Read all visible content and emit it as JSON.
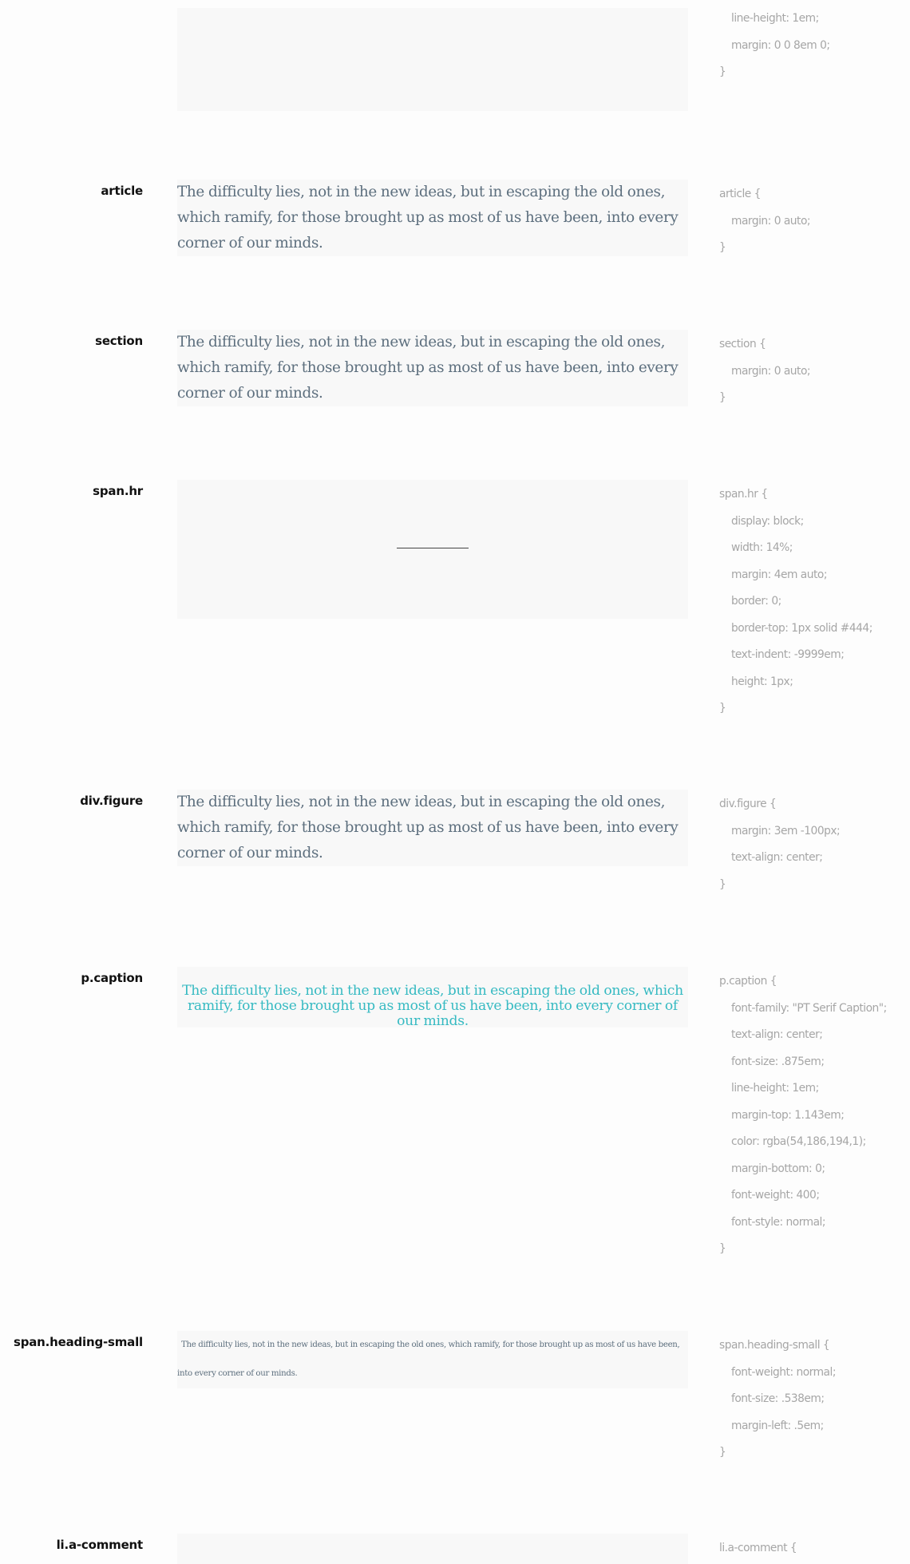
{
  "sample_text": "The difficulty lies, not in the new ideas, but in escaping the old ones, which ramify, for those brought up as most of us have been, into every corner of our minds.",
  "blocks": [
    {
      "selector": "",
      "rules": [
        "line-height: 1em;",
        "margin: 0 0 8em 0;"
      ],
      "close": "}"
    },
    {
      "selector": "article",
      "open": "article {",
      "rules": [
        "margin: 0 auto;"
      ],
      "close": "}"
    },
    {
      "selector": "section",
      "open": "section {",
      "rules": [
        "margin: 0 auto;"
      ],
      "close": "}"
    },
    {
      "selector": "span.hr",
      "open": "span.hr {",
      "rules": [
        "display: block;",
        "width: 14%;",
        "margin: 4em auto;",
        "border: 0;",
        "border-top: 1px solid #444;",
        "text-indent: -9999em;",
        "height: 1px;"
      ],
      "close": "}"
    },
    {
      "selector": "div.figure",
      "open": "div.figure {",
      "rules": [
        "margin: 3em -100px;",
        "text-align: center;"
      ],
      "close": "}"
    },
    {
      "selector": "p.caption",
      "open": "p.caption {",
      "rules": [
        "font-family: \"PT Serif Caption\";",
        "text-align: center;",
        "font-size: .875em;",
        "line-height: 1em;",
        "margin-top: 1.143em;",
        "color: rgba(54,186,194,1);",
        "margin-bottom: 0;",
        "font-weight: 400;",
        "font-style: normal;"
      ],
      "close": "}"
    },
    {
      "selector": "span.heading-small",
      "open": "span.heading-small {",
      "rules": [
        "font-weight: normal;",
        "font-size: .538em;",
        "margin-left: .5em;"
      ],
      "close": "}"
    },
    {
      "selector": "li.a-comment",
      "open": "li.a-comment {",
      "rules": [],
      "close": ""
    }
  ],
  "colors": {
    "page_background": "#fdfdfd",
    "sample_background": "#f8f8f8",
    "sample_text": "#5d6f7e",
    "caption_text": "#36bac2",
    "code_text": "#a6a6a6",
    "hr_line": "#444444"
  }
}
